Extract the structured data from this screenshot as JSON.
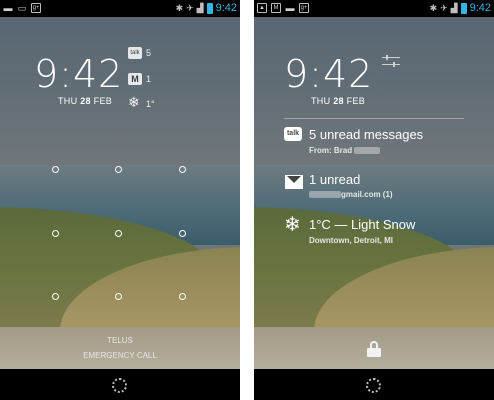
{
  "status_bar": {
    "time": "9:42",
    "left_icons": [
      "talk-icon",
      "message-icon",
      "google-plus-icon"
    ],
    "left_icons_right_screen": [
      "image-icon",
      "gmail-icon",
      "talk-icon",
      "google-plus-icon"
    ]
  },
  "left_screen": {
    "time": "9:42",
    "date": {
      "weekday": "THU",
      "day": "28",
      "month": "FEB"
    },
    "notifications": [
      {
        "icon": "talk-icon",
        "glyph": "talk",
        "count": "5"
      },
      {
        "icon": "gmail-icon",
        "glyph": "M",
        "count": "1"
      },
      {
        "icon": "snowflake-icon",
        "glyph": "❄",
        "count": "1°"
      }
    ],
    "carrier": "TELUS",
    "emergency_call": "EMERGENCY CALL"
  },
  "right_screen": {
    "time": "9:42",
    "date": {
      "weekday": "THU",
      "day": "28",
      "month": "FEB"
    },
    "notifications": [
      {
        "icon": "talk-icon",
        "glyph": "talk",
        "title": "5 unread messages",
        "subtitle": "From: Brad"
      },
      {
        "icon": "gmail-icon",
        "glyph": "M",
        "title": "1 unread",
        "subtitle": "gmail.com (1)"
      },
      {
        "icon": "snowflake-icon",
        "glyph": "❄",
        "title": "1°C — Light Snow",
        "subtitle": "Downtown, Detroit, MI"
      }
    ]
  }
}
